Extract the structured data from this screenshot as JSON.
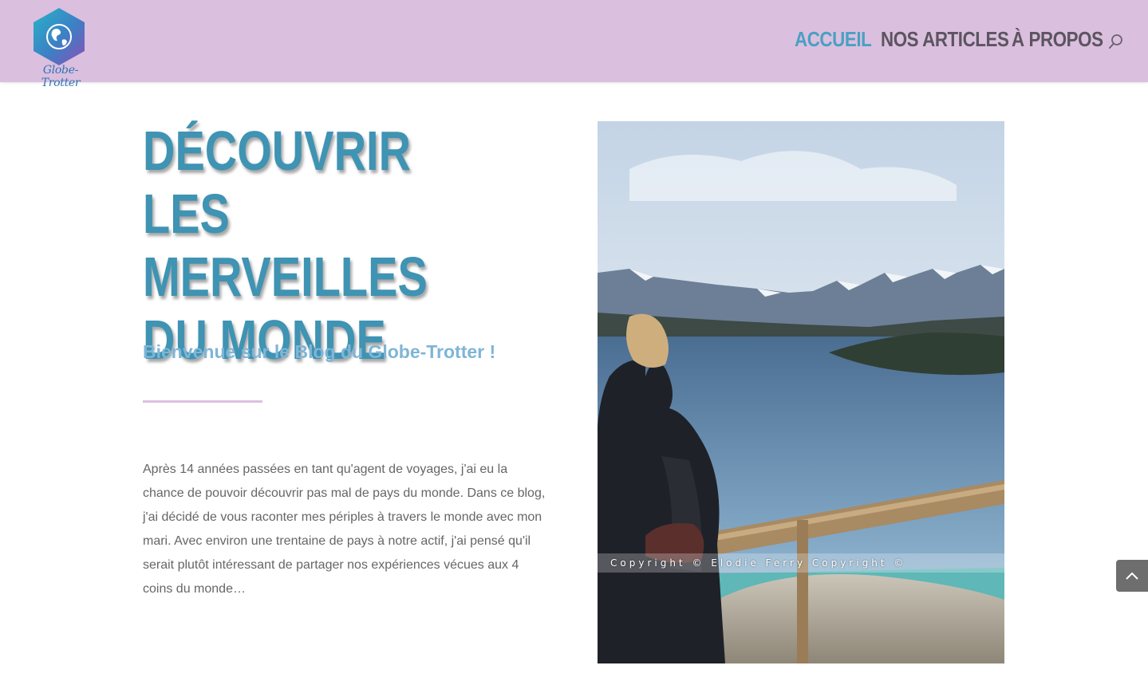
{
  "header": {
    "logo_text": "Globe-Trotter",
    "nav": [
      {
        "label": "ACCUEIL",
        "active": true
      },
      {
        "label": "NOS ARTICLES",
        "active": false
      },
      {
        "label": "À PROPOS",
        "active": false
      }
    ],
    "search_icon": "search-icon"
  },
  "hero": {
    "title": "DÉCOUVRIR LES MERVEILLES DU MONDE",
    "subtitle": "Bienvenue sur le Blog du Globe-Trotter !",
    "intro": "Après 14 années passées en tant qu'agent de voyages, j'ai eu la chance de pouvoir découvrir pas mal de pays du monde. Dans ce blog, j'ai décidé de vous raconter mes périples à travers le monde avec mon mari. Avec environ une trentaine de pays à notre actif, j'ai pensé qu'il serait plutôt intéressant de partager nos expériences vécues aux 4 coins du monde…"
  },
  "photo": {
    "watermark": "Copyright © Elodie Ferry     Copyright ©"
  },
  "colors": {
    "header_bg": "#dbbfdf",
    "accent": "#4aa0c2",
    "nav_text": "#5b5560"
  },
  "back_to_top_icon": "chevron-up-icon"
}
